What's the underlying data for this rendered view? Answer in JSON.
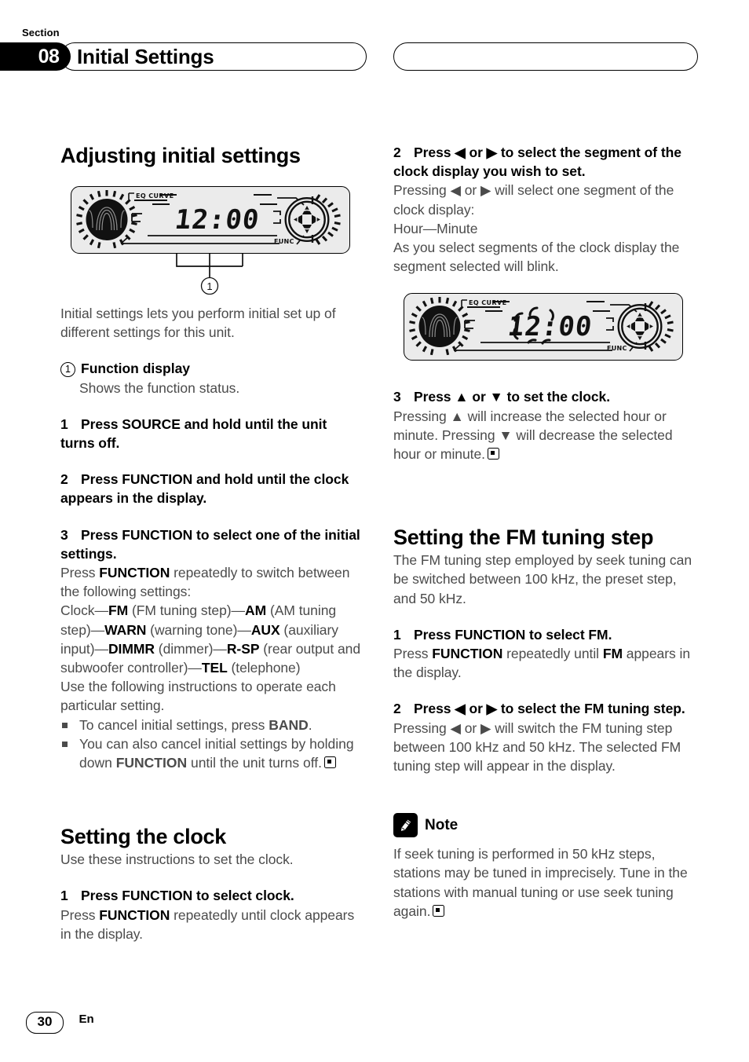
{
  "header": {
    "section_word": "Section",
    "section_number": "08",
    "title": "Initial Settings",
    "right_box_text": ""
  },
  "left_column": {
    "heading": "Adjusting initial settings",
    "figure1": {
      "eq_label": "EQ CURVE",
      "func_label": "FUNC",
      "display_value": "12:00",
      "callout_number": "1"
    },
    "intro": "Initial settings lets you perform initial set up of different settings for this unit.",
    "callout": {
      "number": "1",
      "label": "Function display",
      "description": "Shows the function status."
    },
    "step1_head_num": "1",
    "step1_head": "Press SOURCE and hold until the unit turns off.",
    "step2_head_num": "2",
    "step2_head": "Press FUNCTION and hold until the clock appears in the display.",
    "step3_head_num": "3",
    "step3_head": "Press FUNCTION to select one of the initial settings.",
    "step3_body_1a": "Press ",
    "step3_body_1b": "FUNCTION",
    "step3_body_1c": " repeatedly to switch between the following settings:",
    "settings_chain": [
      {
        "plain": "Clock",
        "bold": ""
      },
      {
        "plain": "—",
        "bold": "FM"
      },
      {
        "plain": " (FM tuning step)—",
        "bold": "AM"
      },
      {
        "plain": " (AM tuning step)—",
        "bold": "WARN"
      },
      {
        "plain": " (warning tone)—",
        "bold": "AUX"
      },
      {
        "plain": " (auxiliary input)—",
        "bold": "DIMMR"
      },
      {
        "plain": " (dimmer)—",
        "bold": "R-SP"
      },
      {
        "plain": " (rear output and subwoofer controller)—",
        "bold": "TEL"
      },
      {
        "plain": " (telephone)",
        "bold": ""
      }
    ],
    "step3_body_2": "Use the following instructions to operate each particular setting.",
    "bullet1_a": "To cancel initial settings, press ",
    "bullet1_b": "BAND",
    "bullet1_c": ".",
    "bullet2_a": "You can also cancel initial settings by holding down ",
    "bullet2_b": "FUNCTION",
    "bullet2_c": " until the unit turns off.",
    "clock_heading": "Setting the clock",
    "clock_intro": "Use these instructions to set the clock.",
    "clock_step1_num": "1",
    "clock_step1_head": "Press FUNCTION to select clock.",
    "clock_step1_body_a": "Press ",
    "clock_step1_body_b": "FUNCTION",
    "clock_step1_body_c": " repeatedly until clock appears in the display."
  },
  "right_column": {
    "step2_num": "2",
    "step2_head": "Press ◀ or ▶ to select the segment of the clock display you wish to set.",
    "step2_body_1": "Pressing ◀ or ▶ will select one segment of the clock display:",
    "step2_body_2": "Hour—Minute",
    "step2_body_3": "As you select segments of the clock display the segment selected will blink.",
    "figure2": {
      "eq_label": "EQ CURVE",
      "func_label": "FUNC",
      "display_value": "12:00"
    },
    "step3_num": "3",
    "step3_head": "Press ▲ or ▼ to set the clock.",
    "step3_body": "Pressing ▲ will increase the selected hour or minute. Pressing ▼ will decrease the selected hour or minute.",
    "fm_heading": "Setting the FM tuning step",
    "fm_intro": "The FM tuning step employed by seek tuning can be switched between 100 kHz, the preset step, and 50 kHz.",
    "fm_step1_num": "1",
    "fm_step1_head": "Press FUNCTION to select FM.",
    "fm_step1_body_a": "Press ",
    "fm_step1_body_b": "FUNCTION",
    "fm_step1_body_c": " repeatedly until ",
    "fm_step1_body_d": "FM",
    "fm_step1_body_e": " appears in the display.",
    "fm_step2_num": "2",
    "fm_step2_head": "Press ◀ or ▶ to select the FM tuning step.",
    "fm_step2_body": "Pressing ◀ or ▶ will switch the FM tuning step between 100 kHz and 50 kHz. The selected FM tuning step will appear in the display.",
    "note_label": "Note",
    "note_body": "If seek tuning is performed in 50 kHz steps, stations may be tuned in imprecisely. Tune in the stations with manual tuning or use seek tuning again."
  },
  "footer": {
    "page_number": "30",
    "language": "En"
  },
  "colors": {
    "ink": "#000000",
    "body_gray": "#4b4b4b",
    "device_face": "#ebebeb"
  }
}
